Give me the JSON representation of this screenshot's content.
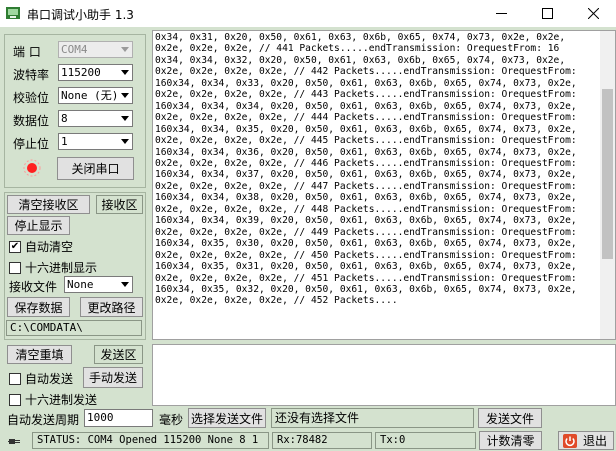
{
  "window": {
    "title": "串口调试小助手 1.3"
  },
  "settings": {
    "port_label": "端  口",
    "port_value": "COM4",
    "baud_label": "波特率",
    "baud_value": "115200",
    "parity_label": "校验位",
    "parity_value": "None (无)",
    "databits_label": "数据位",
    "databits_value": "8",
    "stopbits_label": "停止位",
    "stopbits_value": "1",
    "toggle_port_label": "关闭串口",
    "indicator_color": "#ff2020"
  },
  "receive_controls": {
    "clear_button": "清空接收区",
    "area_label": "接收区",
    "stop_display": "停止显示",
    "auto_clear": "自动清空",
    "auto_clear_checked": true,
    "hex_display": "十六进制显示",
    "hex_display_checked": false,
    "file_label": "接收文件",
    "file_value": "None",
    "save_button": "保存数据",
    "change_path_button": "更改路径",
    "path": "C:\\COMDATA\\"
  },
  "receive_area": {
    "text": "0x34, 0x31, 0x20, 0x50, 0x61, 0x63, 0x6b, 0x65, 0x74, 0x73, 0x2e, 0x2e,\n0x2e, 0x2e, 0x2e, // 441 Packets.....endTransmission: OrequestFrom: 16\n0x34, 0x34, 0x32, 0x20, 0x50, 0x61, 0x63, 0x6b, 0x65, 0x74, 0x73, 0x2e,\n0x2e, 0x2e, 0x2e, 0x2e, // 442 Packets.....endTransmission: OrequestFrom:\n160x34, 0x34, 0x33, 0x20, 0x50, 0x61, 0x63, 0x6b, 0x65, 0x74, 0x73, 0x2e,\n0x2e, 0x2e, 0x2e, 0x2e, // 443 Packets.....endTransmission: OrequestFrom:\n160x34, 0x34, 0x34, 0x20, 0x50, 0x61, 0x63, 0x6b, 0x65, 0x74, 0x73, 0x2e,\n0x2e, 0x2e, 0x2e, 0x2e, // 444 Packets.....endTransmission: OrequestFrom:\n160x34, 0x34, 0x35, 0x20, 0x50, 0x61, 0x63, 0x6b, 0x65, 0x74, 0x73, 0x2e,\n0x2e, 0x2e, 0x2e, 0x2e, // 445 Packets.....endTransmission: OrequestFrom:\n160x34, 0x34, 0x36, 0x20, 0x50, 0x61, 0x63, 0x6b, 0x65, 0x74, 0x73, 0x2e,\n0x2e, 0x2e, 0x2e, 0x2e, // 446 Packets.....endTransmission: OrequestFrom:\n160x34, 0x34, 0x37, 0x20, 0x50, 0x61, 0x63, 0x6b, 0x65, 0x74, 0x73, 0x2e,\n0x2e, 0x2e, 0x2e, 0x2e, // 447 Packets.....endTransmission: OrequestFrom:\n160x34, 0x34, 0x38, 0x20, 0x50, 0x61, 0x63, 0x6b, 0x65, 0x74, 0x73, 0x2e,\n0x2e, 0x2e, 0x2e, 0x2e, // 448 Packets.....endTransmission: OrequestFrom:\n160x34, 0x34, 0x39, 0x20, 0x50, 0x61, 0x63, 0x6b, 0x65, 0x74, 0x73, 0x2e,\n0x2e, 0x2e, 0x2e, 0x2e, // 449 Packets.....endTransmission: OrequestFrom:\n160x34, 0x35, 0x30, 0x20, 0x50, 0x61, 0x63, 0x6b, 0x65, 0x74, 0x73, 0x2e,\n0x2e, 0x2e, 0x2e, 0x2e, // 450 Packets.....endTransmission: OrequestFrom:\n160x34, 0x35, 0x31, 0x20, 0x50, 0x61, 0x63, 0x6b, 0x65, 0x74, 0x73, 0x2e,\n0x2e, 0x2e, 0x2e, 0x2e, // 451 Packets.....endTransmission: OrequestFrom:\n160x34, 0x35, 0x32, 0x20, 0x50, 0x61, 0x63, 0x6b, 0x65, 0x74, 0x73, 0x2e,\n0x2e, 0x2e, 0x2e, 0x2e, // 452 Packets....",
    "scroll_position": 0.42
  },
  "send_controls": {
    "clear_button": "清空重填",
    "area_label": "发送区",
    "auto_send": "自动发送",
    "auto_send_checked": false,
    "manual_send_button": "手动发送",
    "hex_send": "十六进制发送",
    "hex_send_checked": false
  },
  "bottom_row": {
    "period_label": "自动发送周期",
    "period_value": "1000",
    "ms_label": "毫秒",
    "select_file_button": "选择发送文件",
    "file_status": "还没有选择文件",
    "send_file_button": "发送文件"
  },
  "status": {
    "text": "STATUS: COM4 Opened 115200 None  8 1",
    "rx": "Rx:78482",
    "tx": "Tx:0",
    "reset_count_button": "计数清零",
    "exit_button": "退出"
  }
}
